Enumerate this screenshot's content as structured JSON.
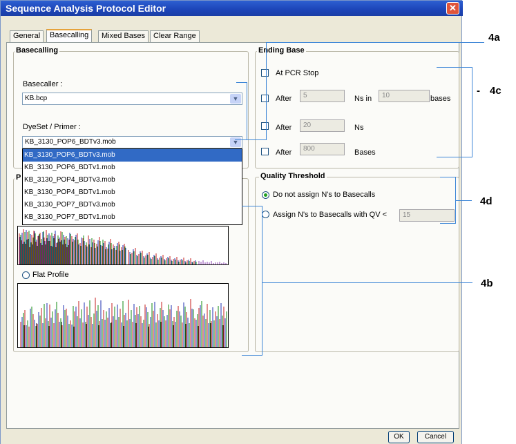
{
  "window": {
    "title": "Sequence Analysis Protocol Editor",
    "close_glyph": "✕"
  },
  "tabs": [
    {
      "label": "General",
      "active": false
    },
    {
      "label": "Basecalling",
      "active": true
    },
    {
      "label": "Mixed Bases",
      "active": false
    },
    {
      "label": "Clear Range",
      "active": false
    }
  ],
  "basecalling": {
    "group_title": "Basecalling",
    "basecaller_label": "Basecaller :",
    "basecaller_value": "KB.bcp",
    "dyeset_label": "DyeSet / Primer :",
    "dyeset_value": "KB_3130_POP6_BDTv3.mob",
    "dyeset_options": [
      "KB_3130_POP6_BDTv3.mob",
      "KB_3130_POP6_BDTv1.mob",
      "KB_3130_POP4_BDTv3.mob",
      "KB_3130_POP4_BDTv1.mob",
      "KB_3130_POP7_BDTv3.mob",
      "KB_3130_POP7_BDTv1.mob"
    ],
    "peak_group_title_visible": "P",
    "flat_profile_label": "Flat Profile"
  },
  "ending_base": {
    "group_title": "Ending Base",
    "at_pcr_stop": "At PCR Stop",
    "after1_label": "After",
    "after1_ns": "5",
    "ns_in_label": "Ns in",
    "after1_bases": "10",
    "bases_lower": "bases",
    "after2_label": "After",
    "after2_value": "20",
    "ns_label": "Ns",
    "after3_label": "After",
    "after3_value": "800",
    "bases_label": "Bases"
  },
  "quality": {
    "group_title": "Quality Threshold",
    "option1": "Do not assign N's to Basecalls",
    "option2": "Assign N's to Basecalls with QV <",
    "qv_value": "15"
  },
  "buttons": {
    "ok": "OK",
    "cancel": "Cancel"
  },
  "callouts": {
    "c4a": "4a",
    "c4b": "4b",
    "c4c": "4c",
    "c4d": "4d",
    "dash": "-"
  },
  "colors": {
    "title_bar": "#1c45b8",
    "accent_lines": "#3a84d6",
    "selection": "#316ac5",
    "radio_selected": "#21a121"
  }
}
